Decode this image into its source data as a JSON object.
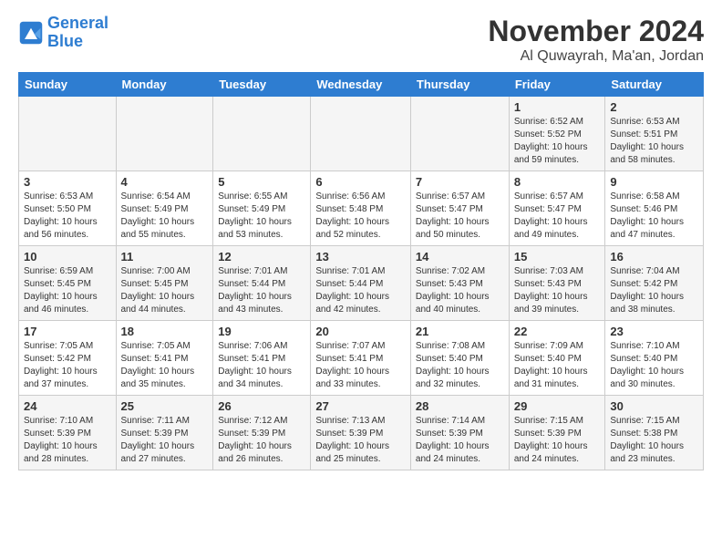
{
  "logo": {
    "line1": "General",
    "line2": "Blue"
  },
  "header": {
    "month": "November 2024",
    "location": "Al Quwayrah, Ma'an, Jordan"
  },
  "weekdays": [
    "Sunday",
    "Monday",
    "Tuesday",
    "Wednesday",
    "Thursday",
    "Friday",
    "Saturday"
  ],
  "weeks": [
    [
      {
        "day": "",
        "info": ""
      },
      {
        "day": "",
        "info": ""
      },
      {
        "day": "",
        "info": ""
      },
      {
        "day": "",
        "info": ""
      },
      {
        "day": "",
        "info": ""
      },
      {
        "day": "1",
        "info": "Sunrise: 6:52 AM\nSunset: 5:52 PM\nDaylight: 10 hours\nand 59 minutes."
      },
      {
        "day": "2",
        "info": "Sunrise: 6:53 AM\nSunset: 5:51 PM\nDaylight: 10 hours\nand 58 minutes."
      }
    ],
    [
      {
        "day": "3",
        "info": "Sunrise: 6:53 AM\nSunset: 5:50 PM\nDaylight: 10 hours\nand 56 minutes."
      },
      {
        "day": "4",
        "info": "Sunrise: 6:54 AM\nSunset: 5:49 PM\nDaylight: 10 hours\nand 55 minutes."
      },
      {
        "day": "5",
        "info": "Sunrise: 6:55 AM\nSunset: 5:49 PM\nDaylight: 10 hours\nand 53 minutes."
      },
      {
        "day": "6",
        "info": "Sunrise: 6:56 AM\nSunset: 5:48 PM\nDaylight: 10 hours\nand 52 minutes."
      },
      {
        "day": "7",
        "info": "Sunrise: 6:57 AM\nSunset: 5:47 PM\nDaylight: 10 hours\nand 50 minutes."
      },
      {
        "day": "8",
        "info": "Sunrise: 6:57 AM\nSunset: 5:47 PM\nDaylight: 10 hours\nand 49 minutes."
      },
      {
        "day": "9",
        "info": "Sunrise: 6:58 AM\nSunset: 5:46 PM\nDaylight: 10 hours\nand 47 minutes."
      }
    ],
    [
      {
        "day": "10",
        "info": "Sunrise: 6:59 AM\nSunset: 5:45 PM\nDaylight: 10 hours\nand 46 minutes."
      },
      {
        "day": "11",
        "info": "Sunrise: 7:00 AM\nSunset: 5:45 PM\nDaylight: 10 hours\nand 44 minutes."
      },
      {
        "day": "12",
        "info": "Sunrise: 7:01 AM\nSunset: 5:44 PM\nDaylight: 10 hours\nand 43 minutes."
      },
      {
        "day": "13",
        "info": "Sunrise: 7:01 AM\nSunset: 5:44 PM\nDaylight: 10 hours\nand 42 minutes."
      },
      {
        "day": "14",
        "info": "Sunrise: 7:02 AM\nSunset: 5:43 PM\nDaylight: 10 hours\nand 40 minutes."
      },
      {
        "day": "15",
        "info": "Sunrise: 7:03 AM\nSunset: 5:43 PM\nDaylight: 10 hours\nand 39 minutes."
      },
      {
        "day": "16",
        "info": "Sunrise: 7:04 AM\nSunset: 5:42 PM\nDaylight: 10 hours\nand 38 minutes."
      }
    ],
    [
      {
        "day": "17",
        "info": "Sunrise: 7:05 AM\nSunset: 5:42 PM\nDaylight: 10 hours\nand 37 minutes."
      },
      {
        "day": "18",
        "info": "Sunrise: 7:05 AM\nSunset: 5:41 PM\nDaylight: 10 hours\nand 35 minutes."
      },
      {
        "day": "19",
        "info": "Sunrise: 7:06 AM\nSunset: 5:41 PM\nDaylight: 10 hours\nand 34 minutes."
      },
      {
        "day": "20",
        "info": "Sunrise: 7:07 AM\nSunset: 5:41 PM\nDaylight: 10 hours\nand 33 minutes."
      },
      {
        "day": "21",
        "info": "Sunrise: 7:08 AM\nSunset: 5:40 PM\nDaylight: 10 hours\nand 32 minutes."
      },
      {
        "day": "22",
        "info": "Sunrise: 7:09 AM\nSunset: 5:40 PM\nDaylight: 10 hours\nand 31 minutes."
      },
      {
        "day": "23",
        "info": "Sunrise: 7:10 AM\nSunset: 5:40 PM\nDaylight: 10 hours\nand 30 minutes."
      }
    ],
    [
      {
        "day": "24",
        "info": "Sunrise: 7:10 AM\nSunset: 5:39 PM\nDaylight: 10 hours\nand 28 minutes."
      },
      {
        "day": "25",
        "info": "Sunrise: 7:11 AM\nSunset: 5:39 PM\nDaylight: 10 hours\nand 27 minutes."
      },
      {
        "day": "26",
        "info": "Sunrise: 7:12 AM\nSunset: 5:39 PM\nDaylight: 10 hours\nand 26 minutes."
      },
      {
        "day": "27",
        "info": "Sunrise: 7:13 AM\nSunset: 5:39 PM\nDaylight: 10 hours\nand 25 minutes."
      },
      {
        "day": "28",
        "info": "Sunrise: 7:14 AM\nSunset: 5:39 PM\nDaylight: 10 hours\nand 24 minutes."
      },
      {
        "day": "29",
        "info": "Sunrise: 7:15 AM\nSunset: 5:39 PM\nDaylight: 10 hours\nand 24 minutes."
      },
      {
        "day": "30",
        "info": "Sunrise: 7:15 AM\nSunset: 5:38 PM\nDaylight: 10 hours\nand 23 minutes."
      }
    ]
  ]
}
